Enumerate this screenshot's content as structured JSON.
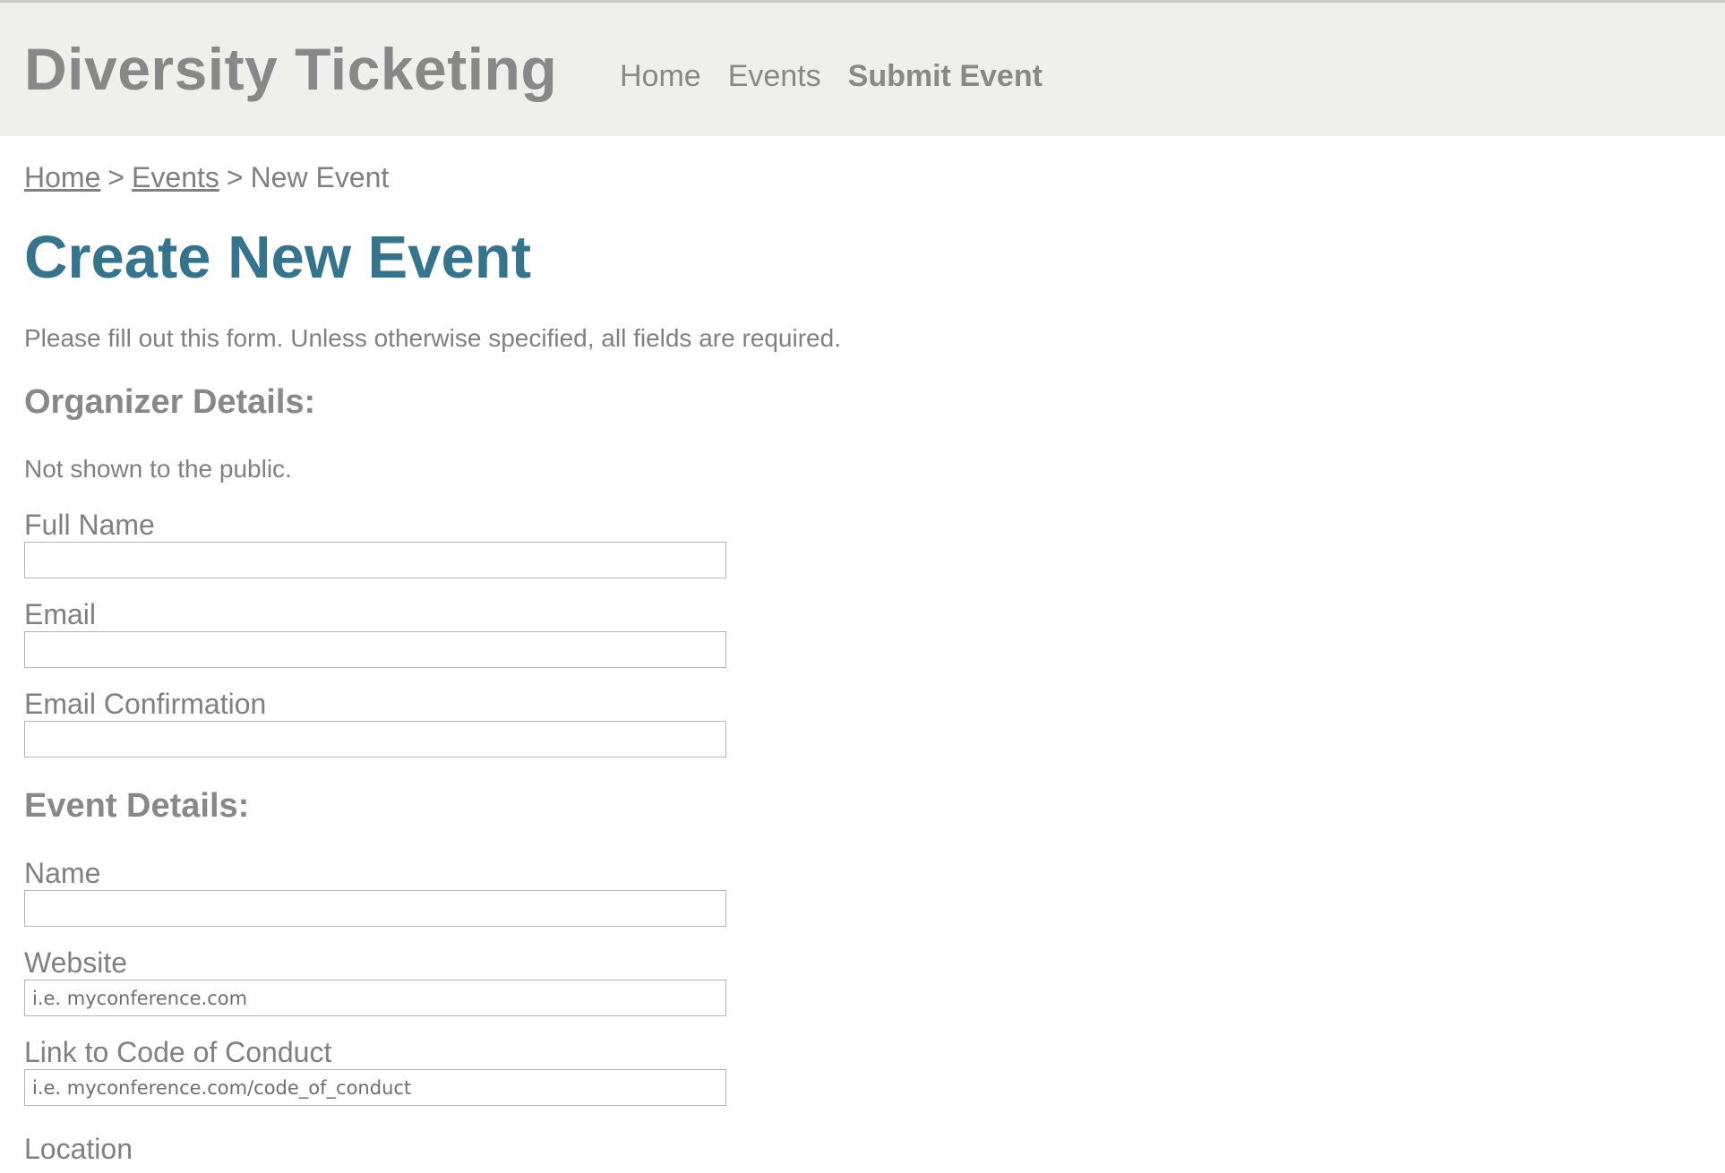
{
  "header": {
    "brand": "Diversity Ticketing",
    "nav": [
      {
        "label": "Home"
      },
      {
        "label": "Events"
      },
      {
        "label": "Submit Event"
      }
    ]
  },
  "breadcrumb": {
    "home": "Home",
    "events": "Events",
    "separator": ">",
    "current": "New Event"
  },
  "page": {
    "title": "Create New Event",
    "intro": "Please fill out this form. Unless otherwise specified, all fields are required."
  },
  "organizer": {
    "heading": "Organizer Details:",
    "note": "Not shown to the public.",
    "full_name": {
      "label": "Full Name",
      "value": "",
      "placeholder": ""
    },
    "email": {
      "label": "Email",
      "value": "",
      "placeholder": ""
    },
    "email_confirmation": {
      "label": "Email Confirmation",
      "value": "",
      "placeholder": ""
    }
  },
  "event": {
    "heading": "Event Details:",
    "name": {
      "label": "Name",
      "value": "",
      "placeholder": ""
    },
    "website": {
      "label": "Website",
      "value": "",
      "placeholder": "i.e. myconference.com"
    },
    "code_of_conduct": {
      "label": "Link to Code of Conduct",
      "value": "",
      "placeholder": "i.e. myconference.com/code_of_conduct"
    },
    "location": {
      "label": "Location"
    }
  },
  "colors": {
    "header_bg": "#efefeb",
    "title_accent": "#34748c",
    "text": "#808080"
  }
}
